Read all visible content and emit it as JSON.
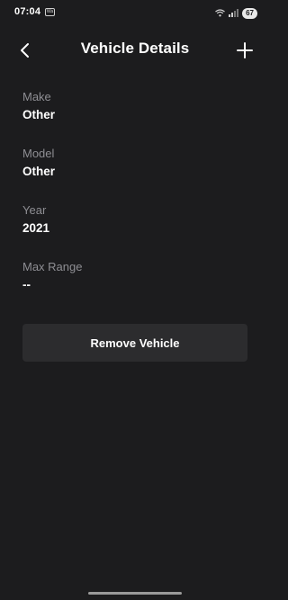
{
  "status_bar": {
    "time": "07:04",
    "app_icon_text": "Wa",
    "battery": "67",
    "icons": [
      "wifi-icon",
      "signal-icon"
    ]
  },
  "header": {
    "title": "Vehicle Details",
    "back_icon": "chevron-left-icon",
    "add_icon": "plus-icon"
  },
  "fields": [
    {
      "label": "Make",
      "value": "Other"
    },
    {
      "label": "Model",
      "value": "Other"
    },
    {
      "label": "Year",
      "value": "2021"
    },
    {
      "label": "Max Range",
      "value": "--"
    }
  ],
  "actions": {
    "remove_label": "Remove Vehicle"
  },
  "colors": {
    "background": "#1c1c1e",
    "button_bg": "#2c2c2e",
    "label_gray": "#8e8e93",
    "text": "#ffffff"
  }
}
